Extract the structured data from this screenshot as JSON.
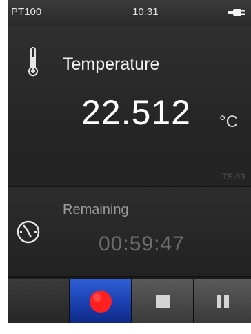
{
  "status_bar": {
    "sensor": "PT100",
    "time": "10:31",
    "power_icon": "plug-icon"
  },
  "temperature": {
    "icon": "thermometer-icon",
    "label": "Temperature",
    "value": "22.512",
    "unit": "°C",
    "scale": "ITS-90"
  },
  "remaining": {
    "icon": "timer-icon",
    "label": "Remaining",
    "value": "00:59:47"
  },
  "controls": {
    "buttons": [
      {
        "name": "blank-button",
        "icon": ""
      },
      {
        "name": "record-button",
        "icon": "record-icon",
        "active": true
      },
      {
        "name": "stop-button",
        "icon": "stop-icon"
      },
      {
        "name": "pause-button",
        "icon": "pause-icon"
      }
    ]
  },
  "colors": {
    "background": "#232323",
    "record_accent": "#1f4fd0",
    "record_dot": "#ff1f1f",
    "primary_text": "#ffffff",
    "dim_text": "#6d6d6d"
  }
}
